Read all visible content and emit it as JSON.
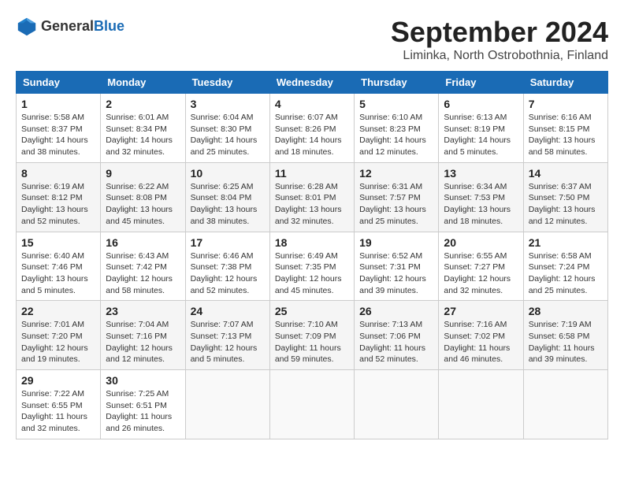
{
  "header": {
    "logo_general": "General",
    "logo_blue": "Blue",
    "month_title": "September 2024",
    "location": "Liminka, North Ostrobothnia, Finland"
  },
  "weekdays": [
    "Sunday",
    "Monday",
    "Tuesday",
    "Wednesday",
    "Thursday",
    "Friday",
    "Saturday"
  ],
  "weeks": [
    [
      {
        "day": "1",
        "info": "Sunrise: 5:58 AM\nSunset: 8:37 PM\nDaylight: 14 hours\nand 38 minutes."
      },
      {
        "day": "2",
        "info": "Sunrise: 6:01 AM\nSunset: 8:34 PM\nDaylight: 14 hours\nand 32 minutes."
      },
      {
        "day": "3",
        "info": "Sunrise: 6:04 AM\nSunset: 8:30 PM\nDaylight: 14 hours\nand 25 minutes."
      },
      {
        "day": "4",
        "info": "Sunrise: 6:07 AM\nSunset: 8:26 PM\nDaylight: 14 hours\nand 18 minutes."
      },
      {
        "day": "5",
        "info": "Sunrise: 6:10 AM\nSunset: 8:23 PM\nDaylight: 14 hours\nand 12 minutes."
      },
      {
        "day": "6",
        "info": "Sunrise: 6:13 AM\nSunset: 8:19 PM\nDaylight: 14 hours\nand 5 minutes."
      },
      {
        "day": "7",
        "info": "Sunrise: 6:16 AM\nSunset: 8:15 PM\nDaylight: 13 hours\nand 58 minutes."
      }
    ],
    [
      {
        "day": "8",
        "info": "Sunrise: 6:19 AM\nSunset: 8:12 PM\nDaylight: 13 hours\nand 52 minutes."
      },
      {
        "day": "9",
        "info": "Sunrise: 6:22 AM\nSunset: 8:08 PM\nDaylight: 13 hours\nand 45 minutes."
      },
      {
        "day": "10",
        "info": "Sunrise: 6:25 AM\nSunset: 8:04 PM\nDaylight: 13 hours\nand 38 minutes."
      },
      {
        "day": "11",
        "info": "Sunrise: 6:28 AM\nSunset: 8:01 PM\nDaylight: 13 hours\nand 32 minutes."
      },
      {
        "day": "12",
        "info": "Sunrise: 6:31 AM\nSunset: 7:57 PM\nDaylight: 13 hours\nand 25 minutes."
      },
      {
        "day": "13",
        "info": "Sunrise: 6:34 AM\nSunset: 7:53 PM\nDaylight: 13 hours\nand 18 minutes."
      },
      {
        "day": "14",
        "info": "Sunrise: 6:37 AM\nSunset: 7:50 PM\nDaylight: 13 hours\nand 12 minutes."
      }
    ],
    [
      {
        "day": "15",
        "info": "Sunrise: 6:40 AM\nSunset: 7:46 PM\nDaylight: 13 hours\nand 5 minutes."
      },
      {
        "day": "16",
        "info": "Sunrise: 6:43 AM\nSunset: 7:42 PM\nDaylight: 12 hours\nand 58 minutes."
      },
      {
        "day": "17",
        "info": "Sunrise: 6:46 AM\nSunset: 7:38 PM\nDaylight: 12 hours\nand 52 minutes."
      },
      {
        "day": "18",
        "info": "Sunrise: 6:49 AM\nSunset: 7:35 PM\nDaylight: 12 hours\nand 45 minutes."
      },
      {
        "day": "19",
        "info": "Sunrise: 6:52 AM\nSunset: 7:31 PM\nDaylight: 12 hours\nand 39 minutes."
      },
      {
        "day": "20",
        "info": "Sunrise: 6:55 AM\nSunset: 7:27 PM\nDaylight: 12 hours\nand 32 minutes."
      },
      {
        "day": "21",
        "info": "Sunrise: 6:58 AM\nSunset: 7:24 PM\nDaylight: 12 hours\nand 25 minutes."
      }
    ],
    [
      {
        "day": "22",
        "info": "Sunrise: 7:01 AM\nSunset: 7:20 PM\nDaylight: 12 hours\nand 19 minutes."
      },
      {
        "day": "23",
        "info": "Sunrise: 7:04 AM\nSunset: 7:16 PM\nDaylight: 12 hours\nand 12 minutes."
      },
      {
        "day": "24",
        "info": "Sunrise: 7:07 AM\nSunset: 7:13 PM\nDaylight: 12 hours\nand 5 minutes."
      },
      {
        "day": "25",
        "info": "Sunrise: 7:10 AM\nSunset: 7:09 PM\nDaylight: 11 hours\nand 59 minutes."
      },
      {
        "day": "26",
        "info": "Sunrise: 7:13 AM\nSunset: 7:06 PM\nDaylight: 11 hours\nand 52 minutes."
      },
      {
        "day": "27",
        "info": "Sunrise: 7:16 AM\nSunset: 7:02 PM\nDaylight: 11 hours\nand 46 minutes."
      },
      {
        "day": "28",
        "info": "Sunrise: 7:19 AM\nSunset: 6:58 PM\nDaylight: 11 hours\nand 39 minutes."
      }
    ],
    [
      {
        "day": "29",
        "info": "Sunrise: 7:22 AM\nSunset: 6:55 PM\nDaylight: 11 hours\nand 32 minutes."
      },
      {
        "day": "30",
        "info": "Sunrise: 7:25 AM\nSunset: 6:51 PM\nDaylight: 11 hours\nand 26 minutes."
      },
      null,
      null,
      null,
      null,
      null
    ]
  ]
}
